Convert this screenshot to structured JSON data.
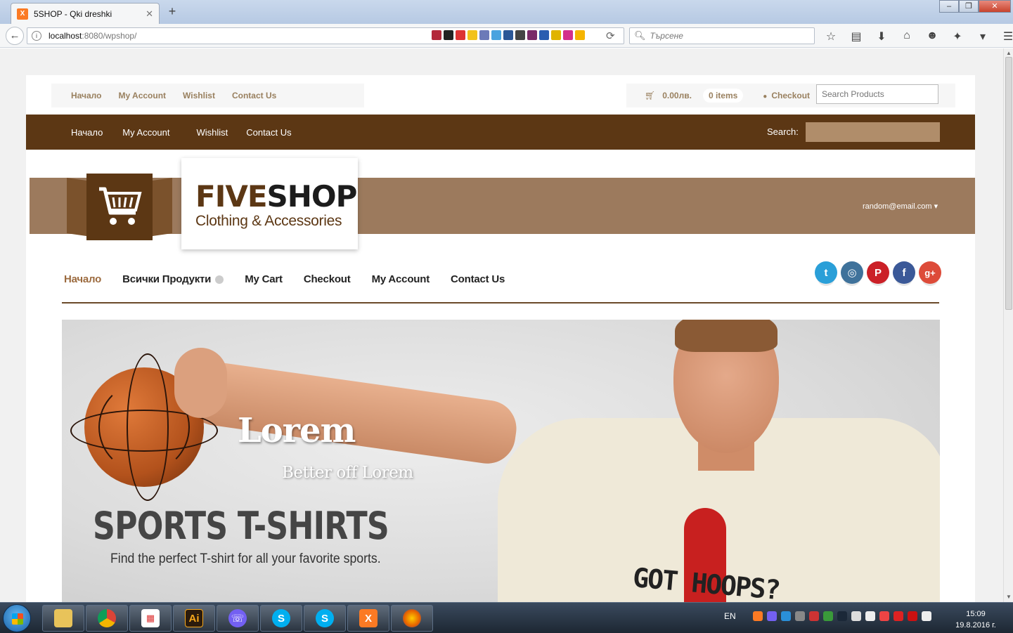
{
  "browser": {
    "tab_title": "5SHOP - Qki dreshki",
    "url_host": "localhost",
    "url_rest": ":8080/wpshop/",
    "search_placeholder": "Търсене"
  },
  "topbar": {
    "links": [
      "Начало",
      "My Account",
      "Wishlist",
      "Contact Us"
    ],
    "cart_amount": "0.00лв.",
    "cart_items": "0 items",
    "checkout": "Checkout",
    "search_placeholder": "Search Products"
  },
  "brownbar": {
    "links": [
      "Начало",
      "My Account",
      "Wishlist",
      "Contact Us"
    ],
    "search_label": "Search:"
  },
  "brand": {
    "name_part1": "FIVE",
    "name_part2": "SHOP",
    "tagline": "Clothing & Accessories",
    "user_email": "random@email.com ▾"
  },
  "mainnav": {
    "items": [
      "Начало",
      "Всички Продукти",
      "My Cart",
      "Checkout",
      "My Account",
      "Contact Us"
    ]
  },
  "social": [
    "twitter-icon",
    "instagram-icon",
    "pinterest-icon",
    "facebook-icon",
    "google-plus-icon"
  ],
  "hero": {
    "title": "Lorem",
    "subtitle": "Better off Lorem",
    "headline": "SPORTS T-SHIRTS",
    "caption": "Find the perfect T-shirt for all your favorite sports.",
    "shirt_text": "GOT HOOPS?"
  },
  "taskbar": {
    "lang": "EN",
    "time": "15:09",
    "date": "19.8.2016 г."
  },
  "colors": {
    "brown_dark": "#5c3714",
    "brown_band": "#9c7a5d",
    "link_tan": "#99805f",
    "twitter": "#2a9fd8",
    "instagram": "#3f729b",
    "pinterest": "#cb2027",
    "facebook": "#3b5998",
    "google_plus": "#dd4b39"
  }
}
